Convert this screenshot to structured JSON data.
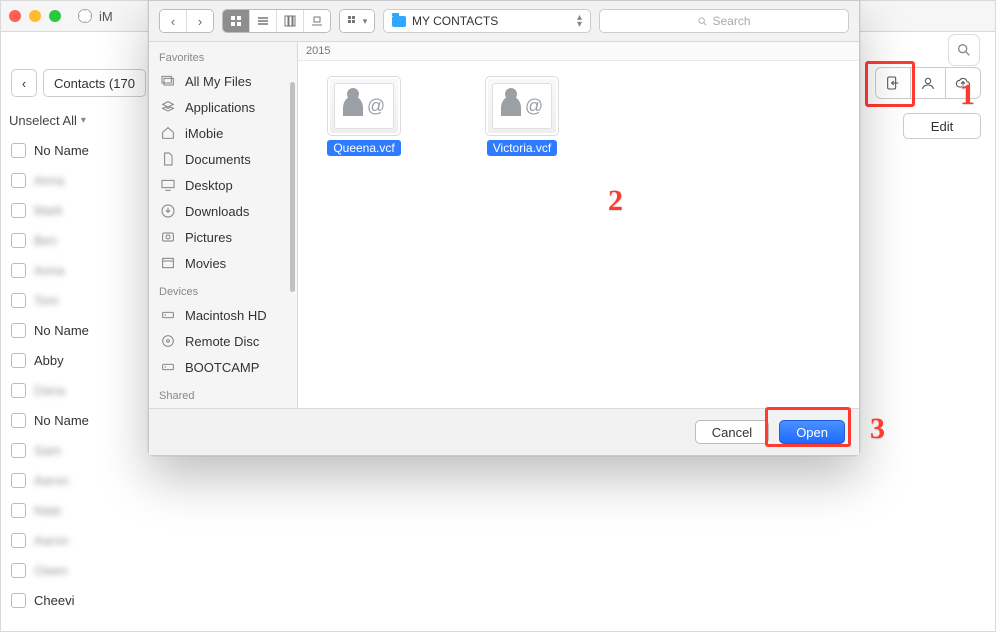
{
  "behind": {
    "title_fragment": "iM",
    "back_button": "‹",
    "breadcrumb": "Contacts (170",
    "unselect_label": "Unselect All",
    "edit_button": "Edit",
    "contacts": [
      {
        "label": "No Name",
        "blur": false
      },
      {
        "label": "Anna",
        "blur": true
      },
      {
        "label": "Mark",
        "blur": true
      },
      {
        "label": "Ben",
        "blur": true
      },
      {
        "label": "Anna",
        "blur": true
      },
      {
        "label": "Tom",
        "blur": true
      },
      {
        "label": "No Name",
        "blur": false
      },
      {
        "label": "Abby",
        "blur": false
      },
      {
        "label": "Dana",
        "blur": true
      },
      {
        "label": "No Name",
        "blur": false
      },
      {
        "label": "Sam",
        "blur": true
      },
      {
        "label": "Aaron",
        "blur": true
      },
      {
        "label": "Nate",
        "blur": true
      },
      {
        "label": "Aaron",
        "blur": true
      },
      {
        "label": "Owen",
        "blur": true
      },
      {
        "label": "Cheevi",
        "blur": false
      }
    ]
  },
  "dialog": {
    "folder_name": "MY CONTACTS",
    "search_placeholder": "Search",
    "year_header": "2015",
    "sidebar": {
      "favorites_heading": "Favorites",
      "devices_heading": "Devices",
      "shared_heading": "Shared",
      "favorites": [
        {
          "name": "All My Files",
          "icon": "all-files-icon"
        },
        {
          "name": "Applications",
          "icon": "apps-icon"
        },
        {
          "name": "iMobie",
          "icon": "home-icon"
        },
        {
          "name": "Documents",
          "icon": "documents-icon"
        },
        {
          "name": "Desktop",
          "icon": "desktop-icon"
        },
        {
          "name": "Downloads",
          "icon": "downloads-icon"
        },
        {
          "name": "Pictures",
          "icon": "pictures-icon"
        },
        {
          "name": "Movies",
          "icon": "movies-icon"
        }
      ],
      "devices": [
        {
          "name": "Macintosh HD",
          "icon": "hdd-icon"
        },
        {
          "name": "Remote Disc",
          "icon": "disc-icon"
        },
        {
          "name": "BOOTCAMP",
          "icon": "hdd-icon"
        }
      ]
    },
    "files": [
      {
        "caption": "Queena.vcf"
      },
      {
        "caption": "Victoria.vcf"
      }
    ],
    "cancel_label": "Cancel",
    "open_label": "Open"
  },
  "annotations": {
    "n1": "1",
    "n2": "2",
    "n3": "3"
  }
}
